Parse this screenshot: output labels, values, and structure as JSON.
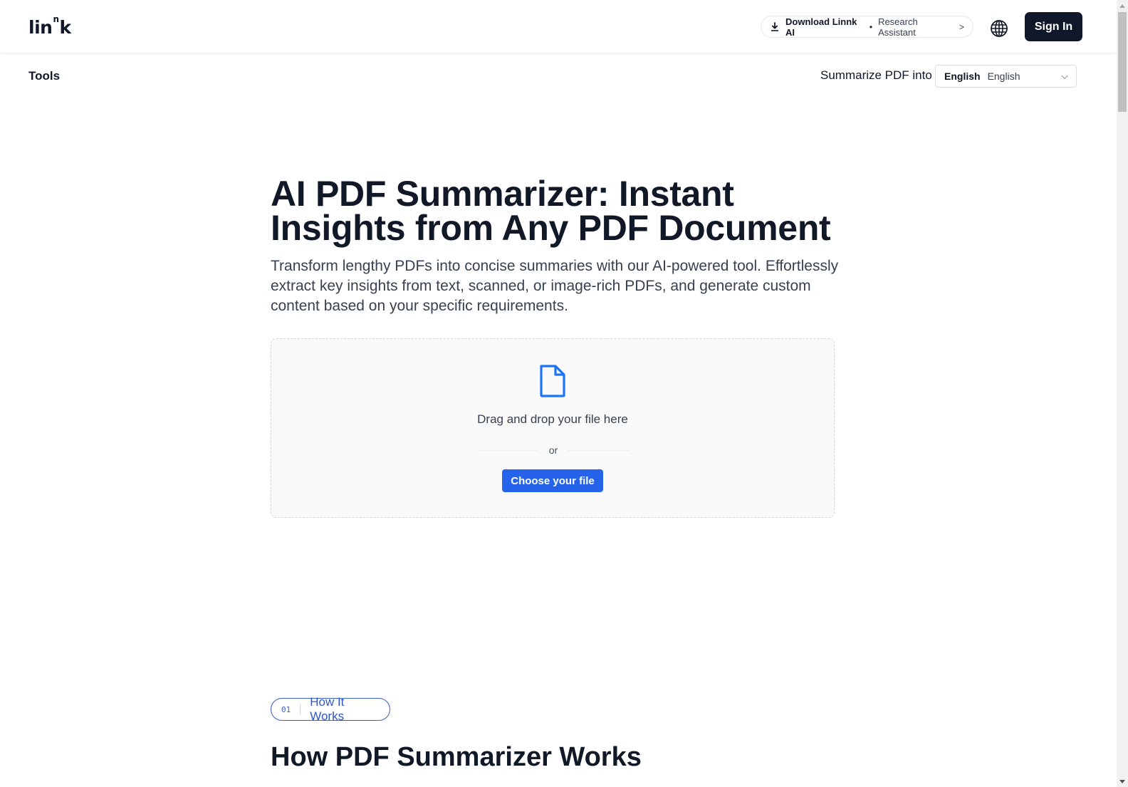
{
  "header": {
    "logo_main": "lin",
    "logo_sup": "n",
    "logo_end": "k",
    "download": {
      "title": "Download Linnk AI",
      "separator": "•",
      "subtitle": "Research Assistant",
      "chevron": ">",
      "icon": "download-icon"
    },
    "language_icon": "globe-icon",
    "signin_label": "Sign In"
  },
  "toolbar": {
    "tools_label": "Tools",
    "summarize_label": "Summarize PDF into",
    "language_select": {
      "native_name": "English",
      "name": "English",
      "icon": "chevron-down-icon"
    }
  },
  "hero": {
    "title_line1": "AI PDF Summarizer: Instant",
    "title_line2": "Insights from Any PDF Document",
    "subtitle": "Transform lengthy PDFs into concise summaries with our AI-powered tool. Effortlessly extract key insights from text, scanned, or image-rich PDFs, and generate custom content based on your specific requirements."
  },
  "upload": {
    "icon": "file-icon",
    "drag_text": "Drag and drop your file here",
    "or_text": "or",
    "choose_label": "Choose your file"
  },
  "how_it_works": {
    "badge_number": "01",
    "badge_label": "How It Works",
    "section_title": "How PDF Summarizer Works"
  },
  "colors": {
    "primary": "#2563eb",
    "dark": "#0f172a",
    "badge_blue": "#2f55c7"
  }
}
